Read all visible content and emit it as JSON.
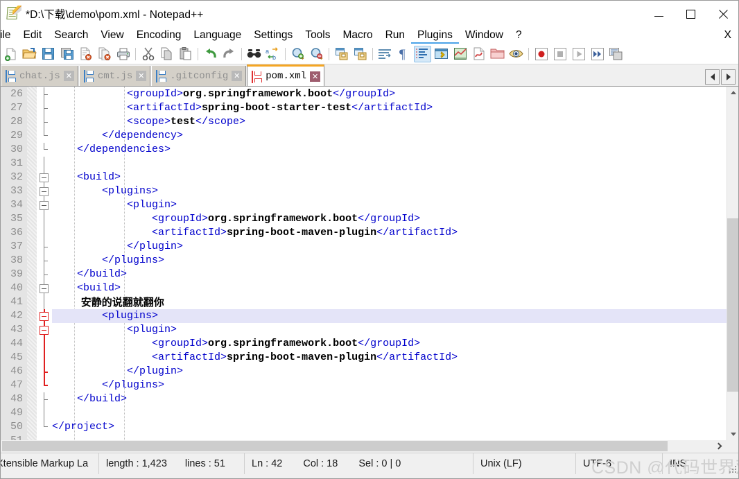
{
  "window": {
    "title": "*D:\\下载\\demo\\pom.xml - Notepad++",
    "icon": "notepad-plus-plus-icon",
    "minimize_label": "Minimize",
    "maximize_label": "Maximize",
    "close_label": "Close"
  },
  "menubar": {
    "items": [
      {
        "label": "ile"
      },
      {
        "label": "Edit"
      },
      {
        "label": "Search"
      },
      {
        "label": "View"
      },
      {
        "label": "Encoding"
      },
      {
        "label": "Language"
      },
      {
        "label": "Settings"
      },
      {
        "label": "Tools"
      },
      {
        "label": "Macro"
      },
      {
        "label": "Run"
      },
      {
        "label": "Plugins"
      },
      {
        "label": "Window"
      },
      {
        "label": "?"
      }
    ],
    "close_doc_label": "X"
  },
  "toolbar": {
    "buttons": [
      {
        "name": "new-file-icon",
        "title": "New"
      },
      {
        "name": "open-file-icon",
        "title": "Open"
      },
      {
        "name": "save-icon",
        "title": "Save"
      },
      {
        "name": "save-all-icon",
        "title": "Save All"
      },
      {
        "name": "close-file-icon",
        "title": "Close"
      },
      {
        "name": "close-all-files-icon",
        "title": "Close All"
      },
      {
        "name": "print-icon",
        "title": "Print"
      },
      {
        "name": "cut-icon",
        "title": "Cut"
      },
      {
        "name": "copy-icon",
        "title": "Copy"
      },
      {
        "name": "paste-icon",
        "title": "Paste"
      },
      {
        "name": "undo-icon",
        "title": "Undo"
      },
      {
        "name": "redo-icon",
        "title": "Redo"
      },
      {
        "name": "find-icon",
        "title": "Find"
      },
      {
        "name": "replace-icon",
        "title": "Replace"
      },
      {
        "name": "zoom-in-icon",
        "title": "Zoom In"
      },
      {
        "name": "zoom-out-icon",
        "title": "Zoom Out"
      },
      {
        "name": "sync-vertical-scroll-icon",
        "title": "Synchronize Vertical Scrolling"
      },
      {
        "name": "sync-horizontal-scroll-icon",
        "title": "Synchronize Horizontal Scrolling"
      },
      {
        "name": "word-wrap-icon",
        "title": "Word Wrap"
      },
      {
        "name": "show-all-characters-icon",
        "title": "Show All Characters"
      },
      {
        "name": "show-indent-guide-icon",
        "title": "Show Indent Guide"
      },
      {
        "name": "user-defined-dialog-icon",
        "title": "UserDefine Dialogue"
      },
      {
        "name": "document-map-icon",
        "title": "Document Map"
      },
      {
        "name": "function-list-icon",
        "title": "Function List"
      },
      {
        "name": "folder-as-workspace-icon",
        "title": "Folder as Workspace"
      },
      {
        "name": "monitoring-icon",
        "title": "Monitoring"
      },
      {
        "name": "record-macro-icon",
        "title": "Start Recording"
      },
      {
        "name": "stop-macro-icon",
        "title": "Stop Recording"
      },
      {
        "name": "play-macro-icon",
        "title": "Play Macro"
      },
      {
        "name": "run-macro-multiple-icon",
        "title": "Run a Macro Multiple Times"
      },
      {
        "name": "save-macro-icon",
        "title": "Save Current Recorded Macro"
      }
    ]
  },
  "tabs": {
    "items": [
      {
        "label": "chat.js",
        "icon": "blue-floppy-icon",
        "active": false,
        "close": "✕"
      },
      {
        "label": "cmt.js",
        "icon": "blue-floppy-icon",
        "active": false,
        "close": "✕"
      },
      {
        "label": ".gitconfig",
        "icon": "blue-floppy-icon",
        "active": false,
        "close": "✕"
      },
      {
        "label": "pom.xml",
        "icon": "red-floppy-icon",
        "active": true,
        "close": "✕"
      }
    ],
    "scroll_left_label": "Scroll tabs left",
    "scroll_right_label": "Scroll tabs right"
  },
  "editor": {
    "first_line": 26,
    "current_line": 42,
    "lines": [
      {
        "n": 26,
        "fold": "tick",
        "segs": [
          {
            "t": "tag",
            "s": "            <groupId>"
          },
          {
            "t": "val",
            "s": "org.springframework.boot"
          },
          {
            "t": "tag",
            "s": "</groupId>"
          }
        ]
      },
      {
        "n": 27,
        "fold": "tick",
        "segs": [
          {
            "t": "tag",
            "s": "            <artifactId>"
          },
          {
            "t": "val",
            "s": "spring-boot-starter-test"
          },
          {
            "t": "tag",
            "s": "</artifactId>"
          }
        ]
      },
      {
        "n": 28,
        "fold": "tick",
        "segs": [
          {
            "t": "tag",
            "s": "            <scope>"
          },
          {
            "t": "val",
            "s": "test"
          },
          {
            "t": "tag",
            "s": "</scope>"
          }
        ]
      },
      {
        "n": 29,
        "fold": "endtick",
        "segs": [
          {
            "t": "tag",
            "s": "        </dependency>"
          }
        ]
      },
      {
        "n": 30,
        "fold": "endtick",
        "segs": [
          {
            "t": "tag",
            "s": "    </dependencies>"
          }
        ]
      },
      {
        "n": 31,
        "fold": "line",
        "segs": []
      },
      {
        "n": 32,
        "fold": "box",
        "segs": [
          {
            "t": "tag",
            "s": "    <build>"
          }
        ]
      },
      {
        "n": 33,
        "fold": "box",
        "segs": [
          {
            "t": "tag",
            "s": "        <plugins>"
          }
        ]
      },
      {
        "n": 34,
        "fold": "box",
        "segs": [
          {
            "t": "tag",
            "s": "            <plugin>"
          }
        ]
      },
      {
        "n": 35,
        "fold": "line",
        "segs": [
          {
            "t": "tag",
            "s": "                <groupId>"
          },
          {
            "t": "val",
            "s": "org.springframework.boot"
          },
          {
            "t": "tag",
            "s": "</groupId>"
          }
        ]
      },
      {
        "n": 36,
        "fold": "line",
        "segs": [
          {
            "t": "tag",
            "s": "                <artifactId>"
          },
          {
            "t": "val",
            "s": "spring-boot-maven-plugin"
          },
          {
            "t": "tag",
            "s": "</artifactId>"
          }
        ]
      },
      {
        "n": 37,
        "fold": "tick",
        "segs": [
          {
            "t": "tag",
            "s": "            </plugin>"
          }
        ]
      },
      {
        "n": 38,
        "fold": "tick",
        "segs": [
          {
            "t": "tag",
            "s": "        </plugins>"
          }
        ]
      },
      {
        "n": 39,
        "fold": "tick",
        "segs": [
          {
            "t": "tag",
            "s": "    </build>"
          }
        ]
      },
      {
        "n": 40,
        "fold": "box",
        "segs": [
          {
            "t": "tag",
            "s": "    <build>"
          }
        ]
      },
      {
        "n": 41,
        "fold": "line",
        "segs": [
          {
            "t": "cjk",
            "s": "        安静的说翻就翻你"
          }
        ]
      },
      {
        "n": 42,
        "fold": "box-red",
        "segs": [
          {
            "t": "tag",
            "s": "        <plugins>"
          }
        ]
      },
      {
        "n": 43,
        "fold": "box-red",
        "segs": [
          {
            "t": "tag",
            "s": "            <plugin>"
          }
        ]
      },
      {
        "n": 44,
        "fold": "line-red",
        "segs": [
          {
            "t": "tag",
            "s": "                <groupId>"
          },
          {
            "t": "val",
            "s": "org.springframework.boot"
          },
          {
            "t": "tag",
            "s": "</groupId>"
          }
        ]
      },
      {
        "n": 45,
        "fold": "line-red",
        "segs": [
          {
            "t": "tag",
            "s": "                <artifactId>"
          },
          {
            "t": "val",
            "s": "spring-boot-maven-plugin"
          },
          {
            "t": "tag",
            "s": "</artifactId>"
          }
        ]
      },
      {
        "n": 46,
        "fold": "tick-red",
        "segs": [
          {
            "t": "tag",
            "s": "            </plugin>"
          }
        ]
      },
      {
        "n": 47,
        "fold": "endtick-red",
        "segs": [
          {
            "t": "tag",
            "s": "        </plugins>"
          }
        ]
      },
      {
        "n": 48,
        "fold": "tick",
        "segs": [
          {
            "t": "tag",
            "s": "    </build>"
          }
        ]
      },
      {
        "n": 49,
        "fold": "line",
        "segs": []
      },
      {
        "n": 50,
        "fold": "endtick",
        "segs": [
          {
            "t": "tag",
            "s": "</project>"
          }
        ]
      },
      {
        "n": 51,
        "fold": "none",
        "segs": []
      }
    ]
  },
  "statusbar": {
    "language": "Xtensible Markup La",
    "length_label": "length : 1,423",
    "lines_label": "lines : 51",
    "ln_label": "Ln : 42",
    "col_label": "Col : 18",
    "sel_label": "Sel : 0 | 0",
    "eol": "Unix (LF)",
    "encoding": "UTF-8",
    "insert_mode": "INS"
  },
  "watermark": {
    "text": "CSDN @代码世界观"
  },
  "colors": {
    "tab_active_top": "#f5a623",
    "tag_blue": "#0000cc",
    "current_line": "#e4e4f8",
    "fold_active_red": "#e02020",
    "gutter_bg": "#e4e4e4"
  }
}
